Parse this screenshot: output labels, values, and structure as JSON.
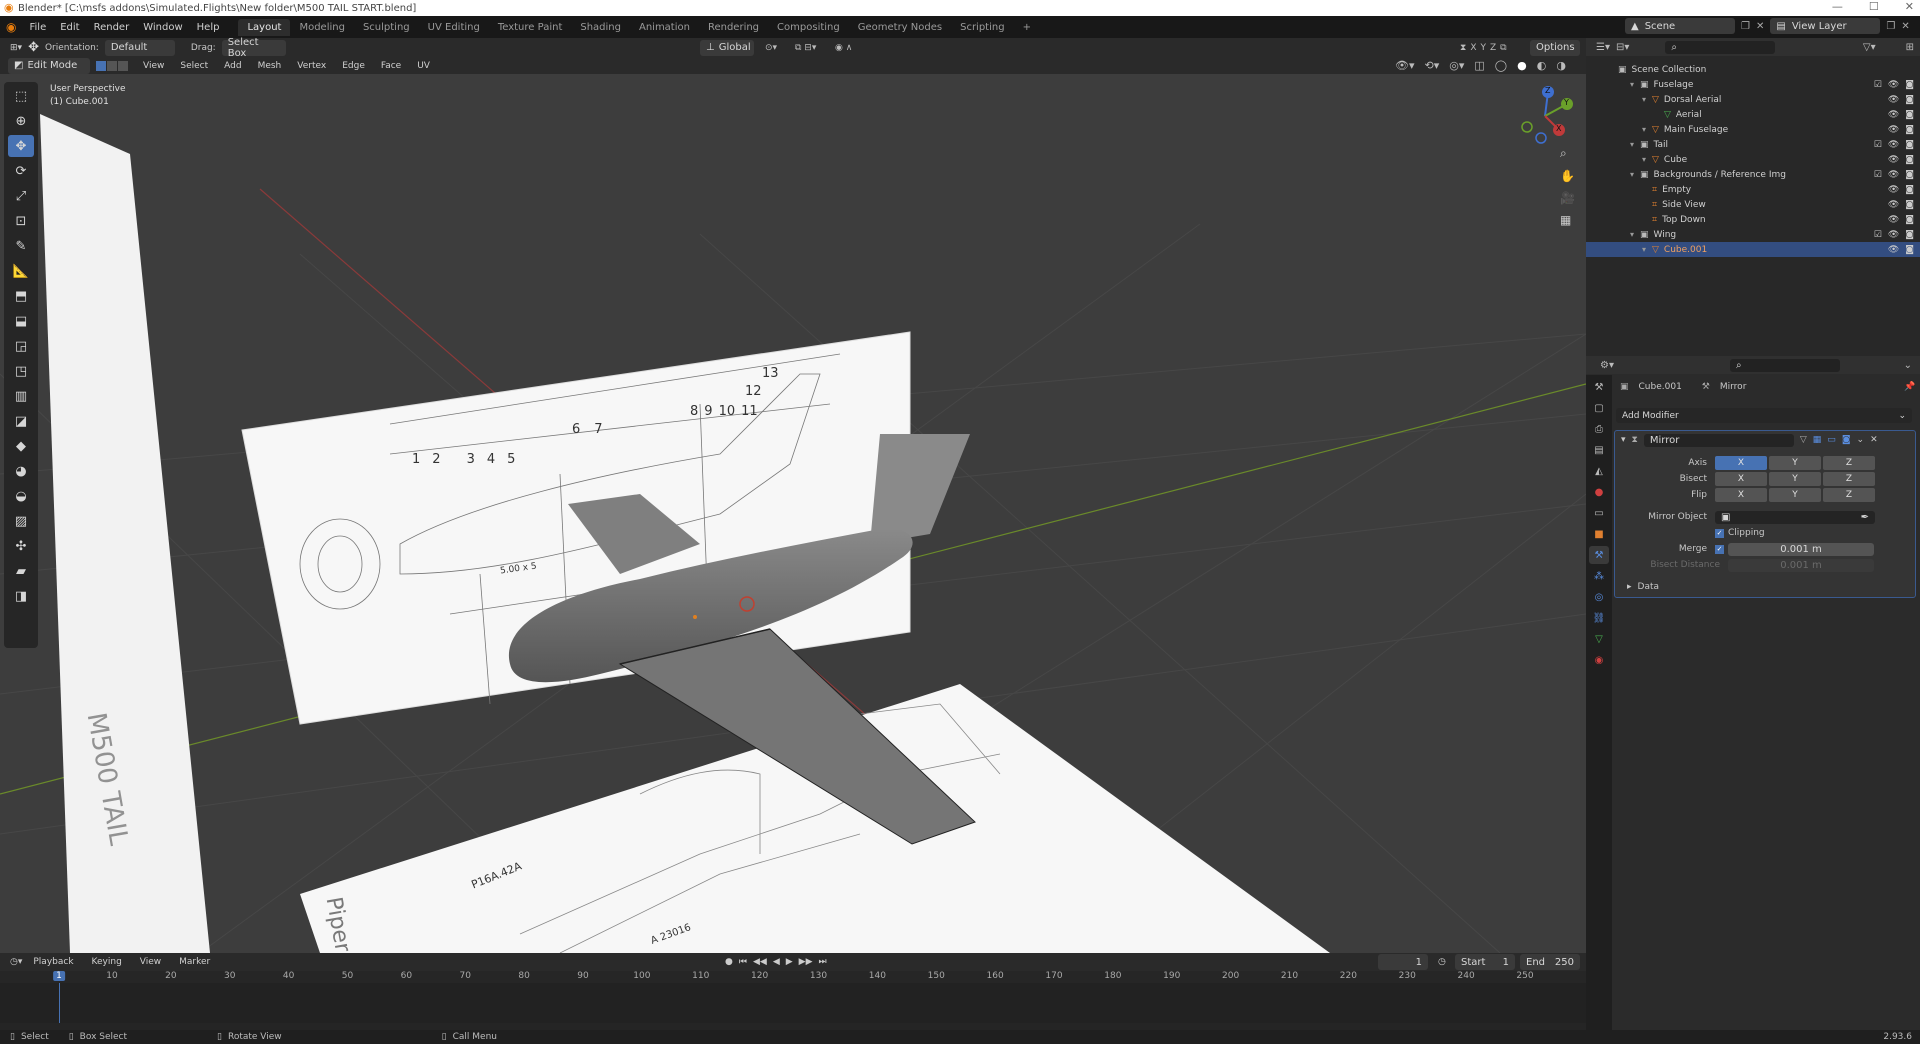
{
  "title_bar": {
    "title": "Blender* [C:\\msfs addons\\Simulated.Flights\\New folder\\M500 TAIL START.blend]",
    "controls": [
      "—",
      "☐",
      "✕"
    ]
  },
  "menu": [
    "File",
    "Edit",
    "Render",
    "Window",
    "Help"
  ],
  "workspaces": {
    "tabs": [
      "Layout",
      "Modeling",
      "Sculpting",
      "UV Editing",
      "Texture Paint",
      "Shading",
      "Animation",
      "Rendering",
      "Compositing",
      "Geometry Nodes",
      "Scripting"
    ],
    "active": "Layout",
    "add": "+"
  },
  "scene": {
    "label": "Scene",
    "view_layer": "View Layer"
  },
  "tool_header": {
    "orientation_label": "Orientation:",
    "orientation": "Default",
    "drag_label": "Drag:",
    "drag": "Select Box",
    "transform_orientation": "Global",
    "axes": [
      "X",
      "Y",
      "Z"
    ],
    "options": "Options"
  },
  "viewport_header": {
    "mode": "Edit Mode",
    "menus": [
      "View",
      "Select",
      "Add",
      "Mesh",
      "Vertex",
      "Edge",
      "Face",
      "UV"
    ]
  },
  "viewport": {
    "perspective": "User Perspective",
    "object": "(1) Cube.001",
    "gizmo_axes": [
      "Z",
      "Y",
      "X"
    ],
    "bg_color": "#3d3d3d"
  },
  "blueprint_numbers": [
    "1",
    "2",
    "3",
    "4",
    "5",
    "6",
    "7",
    "8",
    "9",
    "10",
    "11",
    "12",
    "13"
  ],
  "blueprint_labels": {
    "front": "5.00 x 5",
    "floor1": "P16A.42A",
    "floor2": "A 23016",
    "side_wall": "M500 TAIL",
    "floor_big": "Piper"
  },
  "outliner": {
    "root": "Scene Collection",
    "items": [
      {
        "label": "Fuselage",
        "type": "collection",
        "depth": 0
      },
      {
        "label": "Dorsal Aerial",
        "type": "object",
        "depth": 1
      },
      {
        "label": "Aerial",
        "type": "mesh",
        "depth": 2
      },
      {
        "label": "Main Fuselage",
        "type": "object",
        "depth": 1
      },
      {
        "label": "Tail",
        "type": "collection",
        "depth": 0
      },
      {
        "label": "Cube",
        "type": "object",
        "depth": 1
      },
      {
        "label": "Backgrounds / Reference Img",
        "type": "collection",
        "depth": 0
      },
      {
        "label": "Empty",
        "type": "empty",
        "depth": 1
      },
      {
        "label": "Side View",
        "type": "empty",
        "depth": 1
      },
      {
        "label": "Top Down",
        "type": "empty",
        "depth": 1
      },
      {
        "label": "Wing",
        "type": "collection",
        "depth": 0
      },
      {
        "label": "Cube.001",
        "type": "object",
        "depth": 1,
        "selected": true
      }
    ]
  },
  "properties": {
    "object": "Cube.001",
    "modifier_label": "Mirror",
    "add_modifier": "Add Modifier",
    "modifier_name": "Mirror",
    "axis_label": "Axis",
    "bisect_label": "Bisect",
    "flip_label": "Flip",
    "axes": [
      "X",
      "Y",
      "Z"
    ],
    "axis_on": [
      true,
      false,
      false
    ],
    "mirror_object_label": "Mirror Object",
    "clipping_label": "Clipping",
    "merge_label": "Merge",
    "merge_value": "0.001 m",
    "bisect_distance_label": "Bisect Distance",
    "bisect_distance_value": "0.001 m",
    "data_label": "Data"
  },
  "timeline": {
    "menus": [
      "Playback",
      "Keying",
      "View",
      "Marker"
    ],
    "current_frame": "1",
    "start_label": "Start",
    "start": "1",
    "end_label": "End",
    "end": "250",
    "ticks": [
      "1",
      "10",
      "20",
      "30",
      "40",
      "50",
      "60",
      "70",
      "80",
      "90",
      "100",
      "110",
      "120",
      "130",
      "140",
      "150",
      "160",
      "170",
      "180",
      "190",
      "200",
      "210",
      "220",
      "230",
      "240",
      "250"
    ]
  },
  "statusbar": {
    "select": "Select",
    "box_select": "Box Select",
    "rotate_view": "Rotate View",
    "call_menu": "Call Menu",
    "version": "2.93.6"
  }
}
